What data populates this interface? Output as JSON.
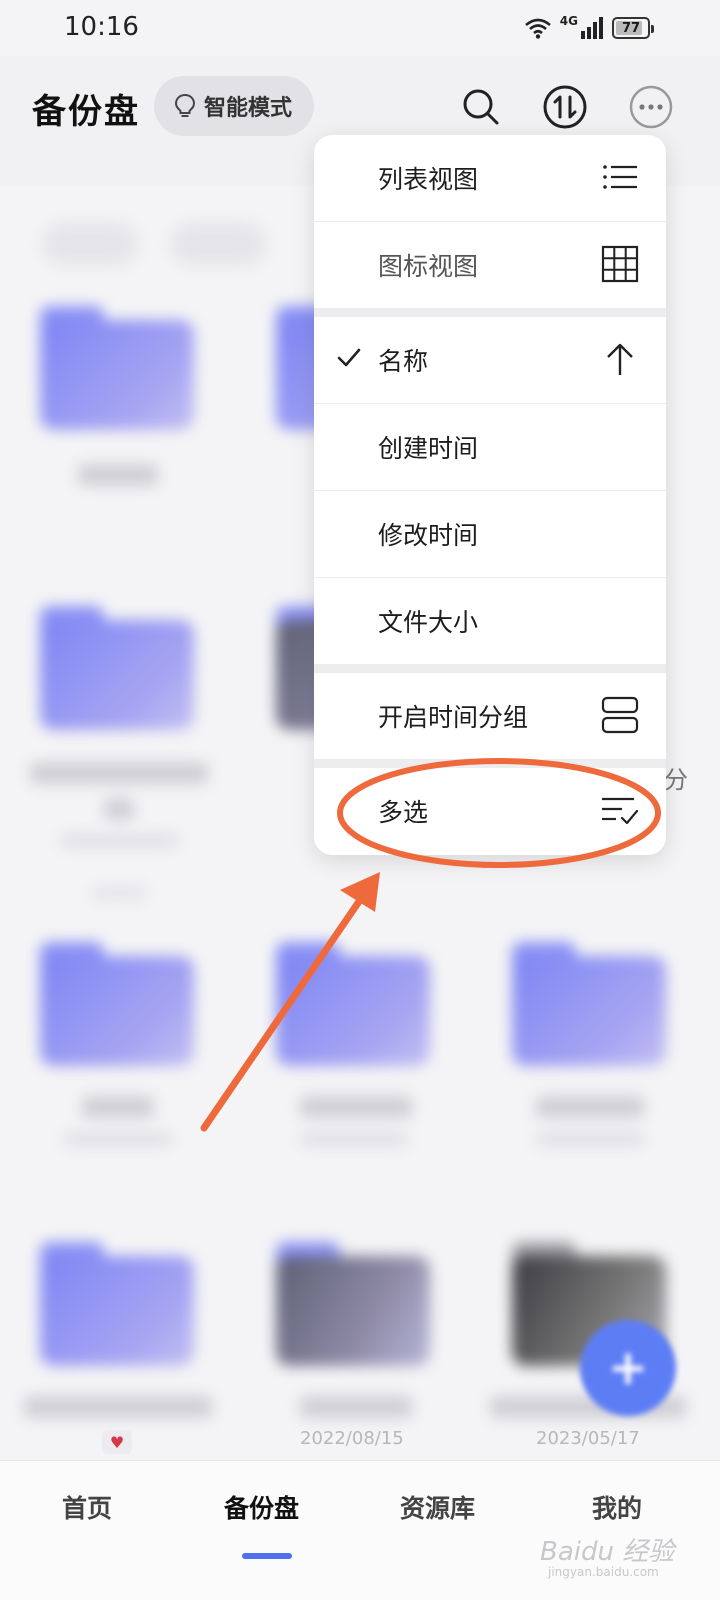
{
  "status_bar": {
    "time": "10:16",
    "network": "4G",
    "battery_level": "77"
  },
  "header": {
    "title": "备份盘",
    "mode_chip": "智能模式",
    "icons": [
      "search-icon",
      "transfer-icon",
      "more-icon"
    ]
  },
  "menu": {
    "view_list": "列表视图",
    "view_grid": "图标视图",
    "sort_name": "名称",
    "sort_created": "创建时间",
    "sort_modified": "修改时间",
    "sort_size": "文件大小",
    "group_by_time": "开启时间分组",
    "multi_select": "多选",
    "selected_sort": "名称",
    "sort_direction": "ascending"
  },
  "files": {
    "partial_label": "分",
    "dates": [
      "2022/08/15",
      "2023/05/17"
    ]
  },
  "bottom_nav": {
    "items": [
      "首页",
      "备份盘",
      "资源库",
      "我的"
    ],
    "active": "备份盘"
  },
  "watermark": {
    "brand": "Baidu 经验",
    "url": "jingyan.baidu.com"
  },
  "colors": {
    "accent": "#4f6ff0",
    "annotation": "#ee6a3c",
    "folder": "#8a90f4"
  }
}
